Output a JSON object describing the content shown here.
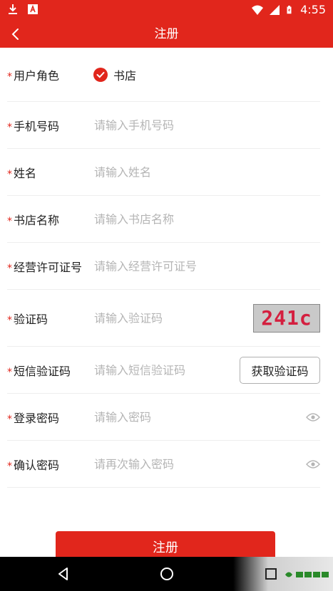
{
  "status_bar": {
    "time": "4:55"
  },
  "app_bar": {
    "title": "注册"
  },
  "form": {
    "role": {
      "label": "用户角色",
      "option": "书店"
    },
    "phone": {
      "label": "手机号码",
      "placeholder": "请输入手机号码"
    },
    "name": {
      "label": "姓名",
      "placeholder": "请输入姓名"
    },
    "store_name": {
      "label": "书店名称",
      "placeholder": "请输入书店名称"
    },
    "license": {
      "label": "经营许可证号",
      "placeholder": "请输入经营许可证号"
    },
    "captcha": {
      "label": "验证码",
      "placeholder": "请输入验证码",
      "image_text": "241c"
    },
    "sms": {
      "label": "短信验证码",
      "placeholder": "请输入短信验证码",
      "button": "获取验证码"
    },
    "password": {
      "label": "登录密码",
      "placeholder": "请输入密码"
    },
    "confirm": {
      "label": "确认密码",
      "placeholder": "请再次输入密码"
    },
    "required_mark": "*"
  },
  "submit": {
    "label": "注册"
  },
  "colors": {
    "primary": "#e1261c",
    "placeholder": "#b5b5b5",
    "divider": "#eeeeee"
  },
  "icons": [
    "download-icon",
    "app-icon",
    "wifi-icon",
    "signal-icon",
    "battery-icon",
    "back-arrow-icon",
    "check-icon",
    "eye-icon",
    "nav-back-icon",
    "nav-home-icon",
    "nav-recents-icon",
    "watermark-logo-icon"
  ]
}
